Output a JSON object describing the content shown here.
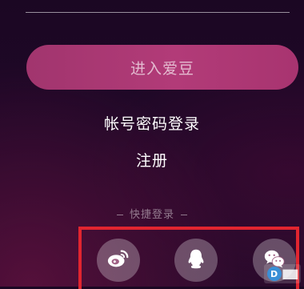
{
  "login": {
    "enter_button_label": "进入爱豆",
    "account_login_label": "帐号密码登录",
    "register_label": "注册",
    "quick_login_title": "快捷登录"
  },
  "social_logins": [
    {
      "name": "weibo",
      "icon": "weibo-icon"
    },
    {
      "name": "qq",
      "icon": "qq-icon"
    },
    {
      "name": "wechat",
      "icon": "wechat-icon"
    }
  ],
  "colors": {
    "background": "#200828",
    "button": "#b23b78",
    "highlight_box": "#e1252f"
  }
}
